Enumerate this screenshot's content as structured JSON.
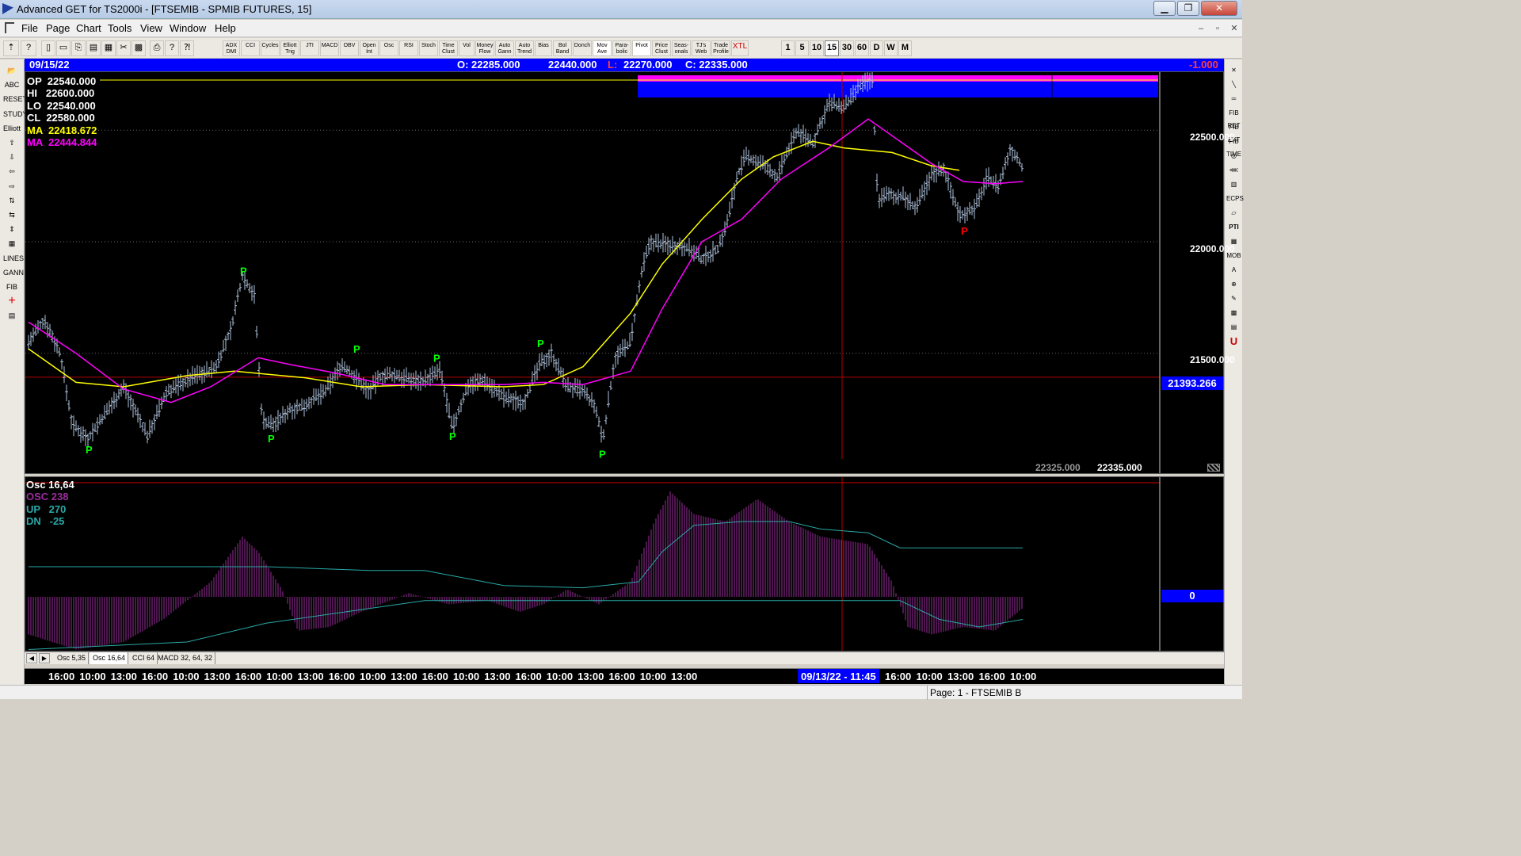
{
  "window": {
    "title": "Advanced GET for TS2000i - [FTSEMIB - SPMIB FUTURES, 15]",
    "minimize": "▁",
    "restore": "❐",
    "close": "✕"
  },
  "menu": {
    "items": [
      "File",
      "Page",
      "Chart",
      "Tools",
      "View",
      "Window",
      "Help"
    ],
    "mdi_minimize": "–",
    "mdi_restore": "▫",
    "mdi_close": "✕"
  },
  "toolbar": {
    "study_buttons": [
      "ADX DMI",
      "CCI",
      "Cycles",
      "Elliott Trig",
      "JTI",
      "MACD",
      "OBV",
      "Open Int",
      "Osc",
      "RSI",
      "Stoch",
      "Time Clust",
      "Vol",
      "Money Flow",
      "Auto Gann",
      "Auto Trend",
      "Bias",
      "Bol Band",
      "Donch",
      "Mov Ave",
      "Para-bolic",
      "Pivot",
      "Price Clust",
      "Seas-onals",
      "TJ's Web",
      "Trade Profile",
      "XTL"
    ],
    "interval_buttons": [
      "1",
      "5",
      "10",
      "15",
      "30",
      "60",
      "D",
      "W",
      "M"
    ],
    "selected_interval": "15"
  },
  "left_tools": [
    "📂",
    "ABC",
    "RESET",
    "STUDY",
    "Elliott",
    "⇧",
    "⇩",
    "⇦",
    "⇨",
    "⇅",
    "⇆",
    "⇕",
    "▦",
    "LINES",
    "GANN",
    "FIB",
    "+",
    "▤"
  ],
  "right_tools": [
    "✕",
    "╲",
    "═",
    "FIB RET",
    "FIB EXT",
    "FIB TIME",
    "◎",
    "⋘",
    "▥",
    "ECPS",
    "▱",
    "PTI",
    "▦",
    "MOB",
    "A",
    "⊕",
    "✎",
    "▩",
    "▤",
    "U"
  ],
  "info_bar": {
    "date": "09/15/22",
    "open": "O: 22285.000",
    "high": "22440.000",
    "low_label": "L:",
    "low": "22270.000",
    "close": "C: 22335.000",
    "change": "-1.000"
  },
  "legend": {
    "op": "OP  22540.000",
    "hi": "HI   22600.000",
    "lo": "LO  22540.000",
    "cl": "CL  22580.000",
    "ma1": "MA  22418.672",
    "ma2": "MA  22444.844"
  },
  "price_axis": {
    "ticks": [
      "22500.000",
      "22000.000",
      "21500.000"
    ],
    "cursor_price": "21393.266",
    "bottom_left_value": "22325.000",
    "bottom_right_value": "22335.000"
  },
  "pivot_label": "P",
  "osc_panel": {
    "title": "Osc 16,64",
    "osc": "OSC 238",
    "up": "UP   270",
    "dn": "DN   -25",
    "zero_label": "0"
  },
  "tabs": [
    "Osc 5,35",
    "Osc 16,64",
    "CCI 64",
    "MACD 32, 64, 32"
  ],
  "active_tab": "Osc 16,64",
  "time_axis": {
    "labels": [
      "16:00",
      "10:00",
      "13:00",
      "16:00",
      "10:00",
      "13:00",
      "16:00",
      "10:00",
      "13:00",
      "16:00",
      "10:00",
      "13:00",
      "16:00",
      "10:00",
      "13:00",
      "16:00",
      "10:00",
      "13:00",
      "16:00",
      "10:00",
      "13:00"
    ],
    "cursor_label": "09/13/22 - 11:45",
    "labels_after": [
      "16:00",
      "10:00",
      "13:00",
      "16:00",
      "10:00"
    ]
  },
  "status": "Page: 1 - FTSEMIB B",
  "colors": {
    "ma_fast": "#ffff00",
    "ma_slow": "#ff00ff",
    "bars": "#b0c4de",
    "pivot": "#00ff00",
    "pivot_red": "#ff0000",
    "osc_hist": "#9b2d9b",
    "osc_lines": "#2aa8a8",
    "cursor": "#b00000"
  },
  "chart_data": {
    "type": "line",
    "title": "FTSEMIB - SPMIB FUTURES, 15",
    "price_axis_ticks": [
      22500,
      22000,
      21500
    ],
    "y_range": [
      20970,
      22760
    ],
    "cursor_price": 21393.266,
    "price_path": [
      [
        0,
        21550
      ],
      [
        20,
        21650
      ],
      [
        40,
        21500
      ],
      [
        55,
        21180
      ],
      [
        75,
        21120
      ],
      [
        95,
        21220
      ],
      [
        120,
        21350
      ],
      [
        150,
        21130
      ],
      [
        175,
        21330
      ],
      [
        210,
        21400
      ],
      [
        235,
        21430
      ],
      [
        255,
        21600
      ],
      [
        270,
        21850
      ],
      [
        285,
        21760
      ],
      [
        295,
        21200
      ],
      [
        310,
        21180
      ],
      [
        330,
        21250
      ],
      [
        345,
        21260
      ],
      [
        375,
        21330
      ],
      [
        395,
        21450
      ],
      [
        410,
        21400
      ],
      [
        430,
        21330
      ],
      [
        445,
        21400
      ],
      [
        465,
        21400
      ],
      [
        485,
        21380
      ],
      [
        500,
        21380
      ],
      [
        520,
        21420
      ],
      [
        535,
        21160
      ],
      [
        555,
        21360
      ],
      [
        575,
        21380
      ],
      [
        600,
        21300
      ],
      [
        625,
        21280
      ],
      [
        645,
        21450
      ],
      [
        660,
        21500
      ],
      [
        680,
        21350
      ],
      [
        700,
        21330
      ],
      [
        715,
        21260
      ],
      [
        725,
        21110
      ],
      [
        740,
        21480
      ],
      [
        760,
        21550
      ],
      [
        775,
        21880
      ],
      [
        785,
        22000
      ],
      [
        800,
        21990
      ],
      [
        830,
        21980
      ],
      [
        850,
        21920
      ],
      [
        870,
        21970
      ],
      [
        880,
        22060
      ],
      [
        895,
        22300
      ],
      [
        905,
        22380
      ],
      [
        925,
        22350
      ],
      [
        945,
        22290
      ],
      [
        970,
        22500
      ],
      [
        990,
        22440
      ],
      [
        1010,
        22620
      ],
      [
        1030,
        22600
      ],
      [
        1050,
        22700
      ],
      [
        1065,
        22730
      ],
      [
        1072,
        22190
      ],
      [
        1085,
        22210
      ],
      [
        1105,
        22200
      ],
      [
        1120,
        22150
      ],
      [
        1140,
        22300
      ],
      [
        1155,
        22330
      ],
      [
        1175,
        22120
      ],
      [
        1195,
        22150
      ],
      [
        1210,
        22290
      ],
      [
        1225,
        22250
      ],
      [
        1240,
        22420
      ],
      [
        1255,
        22330
      ]
    ],
    "ma_fast_path": [
      [
        0,
        21520
      ],
      [
        60,
        21370
      ],
      [
        120,
        21350
      ],
      [
        200,
        21400
      ],
      [
        260,
        21420
      ],
      [
        350,
        21390
      ],
      [
        420,
        21350
      ],
      [
        500,
        21360
      ],
      [
        600,
        21350
      ],
      [
        650,
        21360
      ],
      [
        700,
        21440
      ],
      [
        760,
        21680
      ],
      [
        800,
        21900
      ],
      [
        850,
        22100
      ],
      [
        900,
        22280
      ],
      [
        940,
        22380
      ],
      [
        990,
        22450
      ],
      [
        1030,
        22420
      ],
      [
        1090,
        22400
      ],
      [
        1140,
        22340
      ],
      [
        1175,
        22320
      ]
    ],
    "ma_slow_path": [
      [
        0,
        21640
      ],
      [
        60,
        21500
      ],
      [
        120,
        21340
      ],
      [
        180,
        21280
      ],
      [
        230,
        21350
      ],
      [
        290,
        21480
      ],
      [
        330,
        21450
      ],
      [
        390,
        21410
      ],
      [
        450,
        21360
      ],
      [
        530,
        21360
      ],
      [
        600,
        21360
      ],
      [
        650,
        21370
      ],
      [
        700,
        21360
      ],
      [
        760,
        21420
      ],
      [
        800,
        21700
      ],
      [
        850,
        22000
      ],
      [
        900,
        22100
      ],
      [
        950,
        22280
      ],
      [
        1010,
        22420
      ],
      [
        1060,
        22550
      ],
      [
        1100,
        22450
      ],
      [
        1140,
        22350
      ],
      [
        1180,
        22270
      ],
      [
        1220,
        22260
      ],
      [
        1255,
        22270
      ]
    ],
    "pivots": [
      {
        "x": 75,
        "price": 21070,
        "color": "pivot"
      },
      {
        "x": 305,
        "price": 21120,
        "color": "pivot"
      },
      {
        "x": 270,
        "price": 21870,
        "color": "pivot"
      },
      {
        "x": 413,
        "price": 21520,
        "color": "pivot"
      },
      {
        "x": 514,
        "price": 21480,
        "color": "pivot"
      },
      {
        "x": 534,
        "price": 21130,
        "color": "pivot"
      },
      {
        "x": 645,
        "price": 21545,
        "color": "pivot"
      },
      {
        "x": 723,
        "price": 21050,
        "color": "pivot"
      },
      {
        "x": 1180,
        "price": 22050,
        "color": "pivot_red"
      }
    ],
    "osc_hist_path": [
      [
        0,
        -50
      ],
      [
        60,
        -70
      ],
      [
        120,
        -60
      ],
      [
        170,
        -30
      ],
      [
        230,
        20
      ],
      [
        270,
        80
      ],
      [
        290,
        60
      ],
      [
        320,
        10
      ],
      [
        340,
        -45
      ],
      [
        380,
        -40
      ],
      [
        420,
        -20
      ],
      [
        480,
        5
      ],
      [
        530,
        -10
      ],
      [
        580,
        -5
      ],
      [
        620,
        -20
      ],
      [
        650,
        -10
      ],
      [
        680,
        10
      ],
      [
        720,
        -10
      ],
      [
        760,
        20
      ],
      [
        790,
        100
      ],
      [
        810,
        140
      ],
      [
        840,
        110
      ],
      [
        880,
        100
      ],
      [
        920,
        130
      ],
      [
        960,
        100
      ],
      [
        1000,
        80
      ],
      [
        1060,
        70
      ],
      [
        1090,
        20
      ],
      [
        1110,
        -40
      ],
      [
        1140,
        -50
      ],
      [
        1180,
        -40
      ],
      [
        1220,
        -45
      ],
      [
        1255,
        -15
      ]
    ],
    "osc_line_up": [
      [
        0,
        40
      ],
      [
        200,
        40
      ],
      [
        300,
        40
      ],
      [
        430,
        35
      ],
      [
        500,
        35
      ],
      [
        600,
        15
      ],
      [
        700,
        12
      ],
      [
        770,
        20
      ],
      [
        800,
        60
      ],
      [
        840,
        95
      ],
      [
        900,
        100
      ],
      [
        960,
        100
      ],
      [
        1000,
        90
      ],
      [
        1060,
        85
      ],
      [
        1100,
        65
      ],
      [
        1255,
        65
      ]
    ],
    "osc_line_dn": [
      [
        0,
        -70
      ],
      [
        200,
        -60
      ],
      [
        300,
        -35
      ],
      [
        400,
        -20
      ],
      [
        500,
        -5
      ],
      [
        600,
        -5
      ],
      [
        700,
        -5
      ],
      [
        1100,
        -5
      ],
      [
        1150,
        -30
      ],
      [
        1200,
        -40
      ],
      [
        1255,
        -30
      ]
    ]
  }
}
